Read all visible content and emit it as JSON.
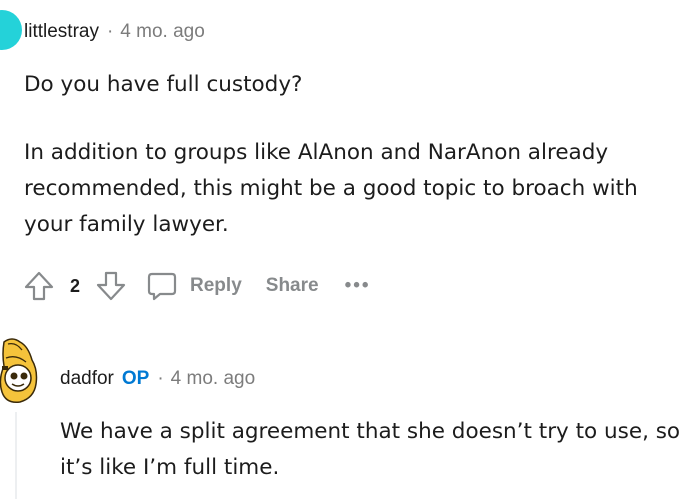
{
  "comment1": {
    "username": "littlestray",
    "separator": "·",
    "time": "4 mo. ago",
    "paragraphs": [
      "Do you have full custody?",
      "In addition to groups like AlAnon and NarAnon already recommended, this might be a good topic to broach with your family lawyer."
    ],
    "actions": {
      "upvote_icon": "upvote-arrow-icon",
      "vote_count": "2",
      "downvote_icon": "downvote-arrow-icon",
      "comment_icon": "comment-bubble-icon",
      "reply_label": "Reply",
      "share_label": "Share",
      "more_label": "•••"
    }
  },
  "comment2": {
    "username": "dadfor",
    "op_badge": "OP",
    "separator": "·",
    "time": "4 mo. ago",
    "body": "We have a split agreement that she doesn’t try to use, so it’s like I’m full time."
  },
  "colors": {
    "text": "#1c1c1c",
    "muted": "#7c7c7c",
    "action": "#878a8c",
    "op_blue": "#0079d3",
    "avatar_teal": "#24d2d9",
    "avatar_yellow": "#f5c33b",
    "thread_line": "#edeff1"
  }
}
